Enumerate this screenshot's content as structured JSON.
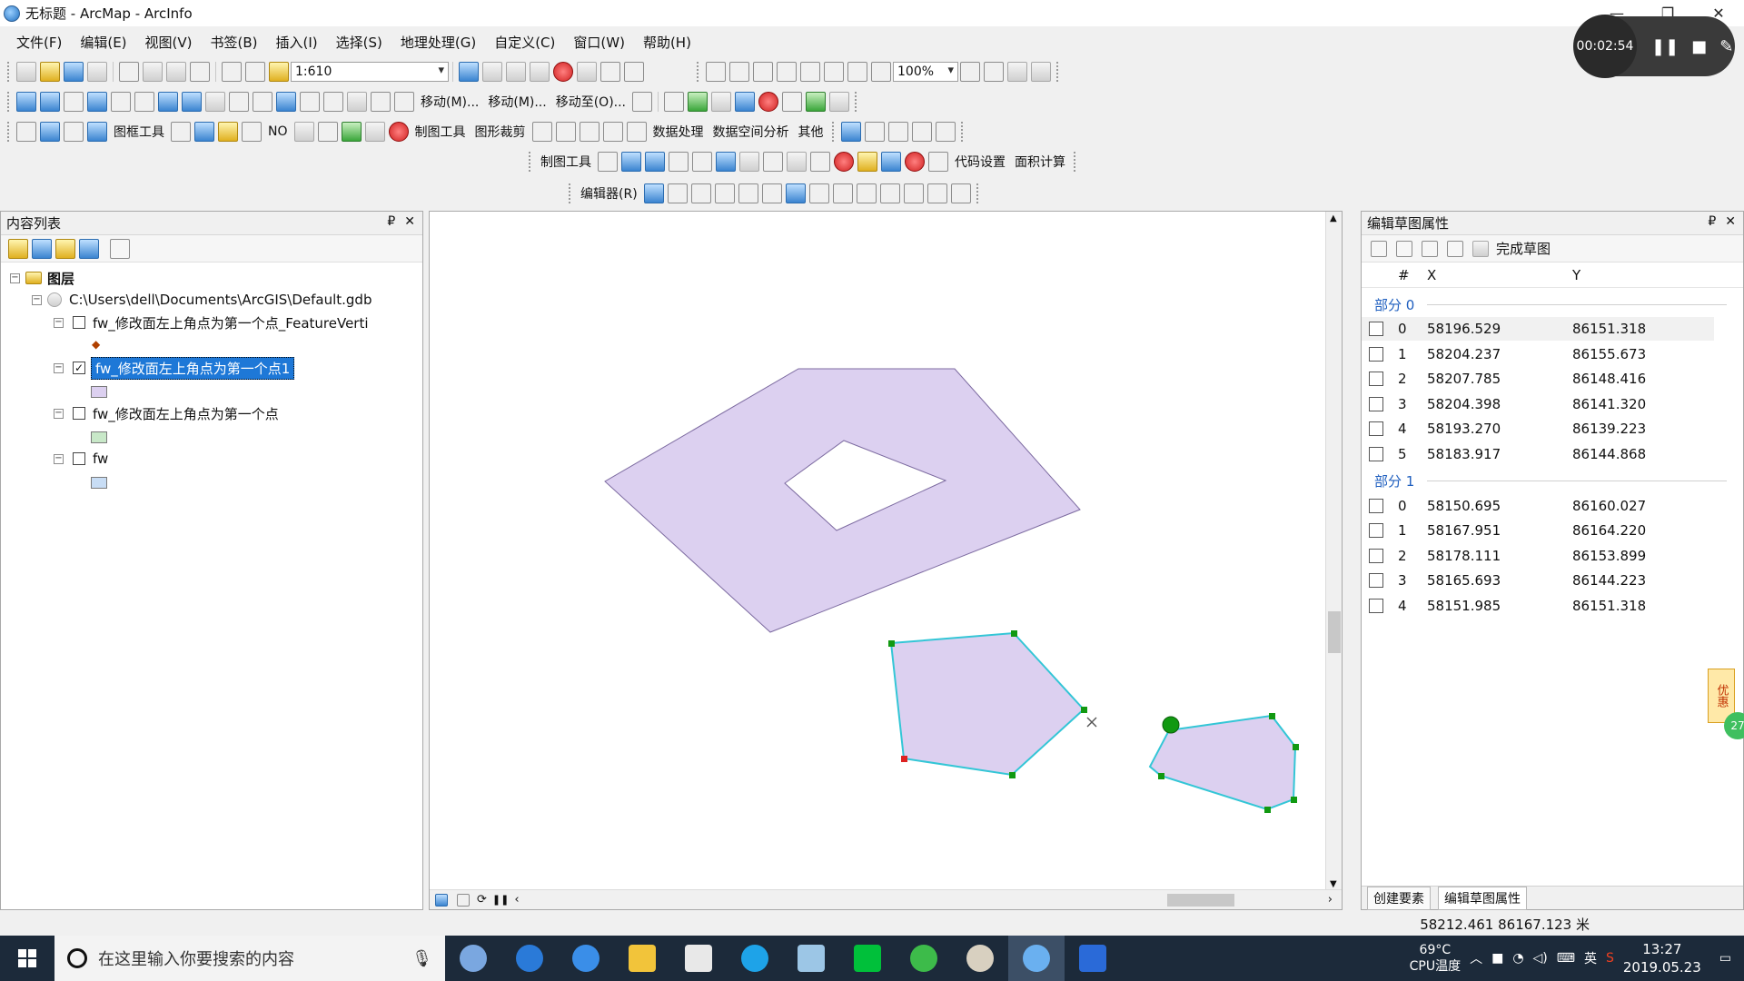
{
  "window": {
    "title": "无标题 - ArcMap - ArcInfo",
    "minimize": "—",
    "restore": "❐",
    "close": "✕"
  },
  "menu": [
    "文件(F)",
    "编辑(E)",
    "视图(V)",
    "书签(B)",
    "插入(I)",
    "选择(S)",
    "地理处理(G)",
    "自定义(C)",
    "窗口(W)",
    "帮助(H)"
  ],
  "toolbar": {
    "scale": "1:610",
    "zoom_percent": "100%",
    "move_m1": "移动(M)...",
    "move_m2": "移动(M)...",
    "move_to": "移动至(O)...",
    "frame_tools": "图框工具",
    "no_label": "NO",
    "drawing_tools": "制图工具",
    "shape_clip": "图形裁剪",
    "data_processing": "数据处理",
    "spatial_analysis": "数据空间分析",
    "other": "其他",
    "drawing_tools2": "制图工具",
    "code_settings": "代码设置",
    "area_calc": "面积计算",
    "editor": "编辑器(R)"
  },
  "toc": {
    "title": "内容列表",
    "pin": "₽",
    "close": "✕",
    "root": "图层",
    "gdb": "C:\\Users\\dell\\Documents\\ArcGIS\\Default.gdb",
    "layers": [
      {
        "name": "fw_修改面左上角点为第一个点_FeatureVerti",
        "checked": false,
        "symbol": "point"
      },
      {
        "name": "fw_修改面左上角点为第一个点1",
        "checked": true,
        "symbol": "#dcd0f0"
      },
      {
        "name": "fw_修改面左上角点为第一个点",
        "checked": false,
        "symbol": "#c8e8c8"
      },
      {
        "name": "fw",
        "checked": false,
        "symbol": "#c8ddf5"
      }
    ]
  },
  "sketch": {
    "title": "编辑草图属性",
    "pin": "₽",
    "close": "✕",
    "finish": "完成草图",
    "cols": {
      "index": "#",
      "x": "X",
      "y": "Y"
    },
    "parts": [
      {
        "label": "部分 0",
        "rows": [
          {
            "i": "0",
            "x": "58196.529",
            "y": "86151.318"
          },
          {
            "i": "1",
            "x": "58204.237",
            "y": "86155.673"
          },
          {
            "i": "2",
            "x": "58207.785",
            "y": "86148.416"
          },
          {
            "i": "3",
            "x": "58204.398",
            "y": "86141.320"
          },
          {
            "i": "4",
            "x": "58193.270",
            "y": "86139.223"
          },
          {
            "i": "5",
            "x": "58183.917",
            "y": "86144.868"
          }
        ]
      },
      {
        "label": "部分 1",
        "rows": [
          {
            "i": "0",
            "x": "58150.695",
            "y": "86160.027"
          },
          {
            "i": "1",
            "x": "58167.951",
            "y": "86164.220"
          },
          {
            "i": "2",
            "x": "58178.111",
            "y": "86153.899"
          },
          {
            "i": "3",
            "x": "58165.693",
            "y": "86144.223"
          },
          {
            "i": "4",
            "x": "58151.985",
            "y": "86151.318"
          }
        ]
      }
    ],
    "tab_create": "创建要素",
    "tab_sketch": "编辑草图属性"
  },
  "status": {
    "coords": "58212.461  86167.123 米"
  },
  "recorder": {
    "time": "00:02:54",
    "pause": "❚❚",
    "stop": "■",
    "pen": "✎"
  },
  "promo": {
    "label": "优惠",
    "badge": "27"
  },
  "taskbar": {
    "search_placeholder": "在这里输入你要搜索的内容",
    "temperature": "69°C",
    "cpu_label": "CPU温度",
    "ime": "英",
    "time": "13:27",
    "date": "2019.05.23"
  },
  "colors": {
    "polygon_fill": "#dcd0f0",
    "polygon_stroke": "#7c6aa0",
    "sketch_edge": "#33c6d6",
    "vertex": "#119911",
    "selected_vertex": "#dd2222",
    "selection_blue": "#1e78d7"
  }
}
